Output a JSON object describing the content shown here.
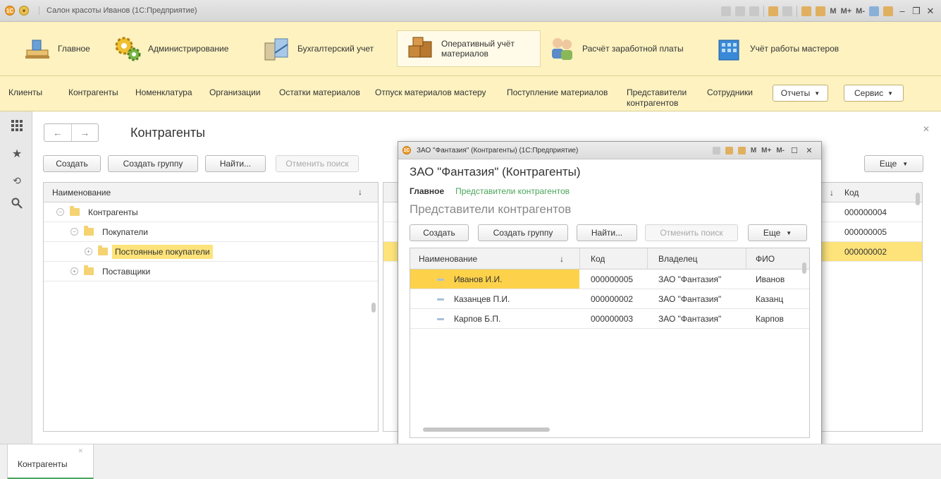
{
  "window": {
    "title": "Салон красоты Иванов  (1С:Предприятие)",
    "memory_labels": [
      "M",
      "M+",
      "M-"
    ]
  },
  "sections": [
    {
      "label": "Главное",
      "icon": "desk-icon"
    },
    {
      "label": "Администрирование",
      "icon": "gears-icon"
    },
    {
      "label": "Бухгалтерский учет",
      "icon": "accounting-icon"
    },
    {
      "label": "Оперативный учёт материалов",
      "icon": "boxes-icon"
    },
    {
      "label": "Расчёт заработной платы",
      "icon": "people-icon"
    },
    {
      "label": "Учёт работы мастеров",
      "icon": "building-icon"
    }
  ],
  "commands": {
    "items": [
      "Клиенты",
      "Контрагенты",
      "Номенклатура",
      "Организации",
      "Остатки материалов",
      "Отпуск материалов мастеру",
      "Поступление материалов",
      "Представители контрагентов",
      "Сотрудники"
    ],
    "reports": "Отчеты",
    "service": "Сервис"
  },
  "main": {
    "title": "Контрагенты",
    "buttons": {
      "create": "Создать",
      "create_group": "Создать группу",
      "find": "Найти...",
      "cancel_search": "Отменить поиск",
      "more": "Еще"
    },
    "tree": {
      "header": "Наименование",
      "rows": [
        {
          "label": "Контрагенты"
        },
        {
          "label": "Покупатели"
        },
        {
          "label": "Постоянные покупатели"
        },
        {
          "label": "Поставщики"
        }
      ]
    },
    "list": {
      "header_code": "Код",
      "codes": [
        "000000004",
        "000000005",
        "000000002"
      ]
    }
  },
  "dialog": {
    "window_title": "ЗАО \"Фантазия\" (Контрагенты)  (1С:Предприятие)",
    "heading": "ЗАО \"Фантазия\" (Контрагенты)",
    "nav_main": "Главное",
    "nav_link": "Представители контрагентов",
    "subtitle": "Представители контрагентов",
    "buttons": {
      "create": "Создать",
      "create_group": "Создать группу",
      "find": "Найти...",
      "cancel_search": "Отменить поиск",
      "more": "Еще"
    },
    "columns": {
      "name": "Наименование",
      "code": "Код",
      "owner": "Владелец",
      "fio": "ФИО"
    },
    "rows": [
      {
        "name": "Иванов И.И.",
        "code": "000000005",
        "owner": "ЗАО \"Фантазия\"",
        "fio": "Иванов"
      },
      {
        "name": "Казанцев П.И.",
        "code": "000000002",
        "owner": "ЗАО \"Фантазия\"",
        "fio": "Казанц"
      },
      {
        "name": "Карпов Б.П.",
        "code": "000000003",
        "owner": "ЗАО \"Фантазия\"",
        "fio": "Карпов"
      }
    ]
  },
  "bottom_tabs": [
    {
      "label": "Контрагенты"
    }
  ],
  "colors": {
    "accent_yellow": "#fde37a",
    "panel_yellow": "#fdf2c0",
    "link_green": "#4aa55a"
  }
}
